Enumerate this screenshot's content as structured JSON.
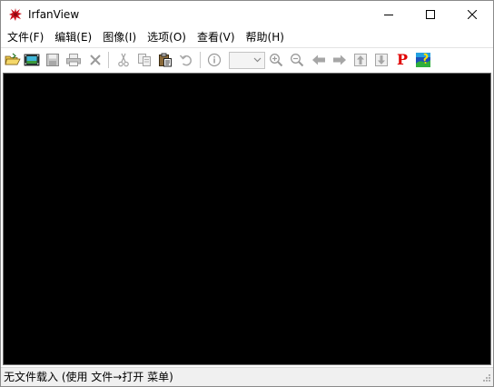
{
  "window": {
    "title": "IrfanView",
    "icon": "irfanview-logo-icon"
  },
  "caption_buttons": [
    {
      "name": "minimize",
      "icon": "minimize-icon"
    },
    {
      "name": "maximize",
      "icon": "maximize-icon"
    },
    {
      "name": "close",
      "icon": "close-icon"
    }
  ],
  "menu": [
    {
      "label": "文件(F)"
    },
    {
      "label": "编辑(E)"
    },
    {
      "label": "图像(I)"
    },
    {
      "label": "选项(O)"
    },
    {
      "label": "查看(V)"
    },
    {
      "label": "帮助(H)"
    }
  ],
  "toolbar": {
    "buttons": [
      {
        "icon": "open-folder-icon",
        "enabled": true
      },
      {
        "icon": "slideshow-icon",
        "enabled": true
      },
      {
        "icon": "save-icon",
        "enabled": false
      },
      {
        "icon": "print-icon",
        "enabled": false
      },
      {
        "icon": "delete-icon",
        "enabled": false
      },
      {
        "icon": "cut-icon",
        "enabled": false
      },
      {
        "icon": "copy-icon",
        "enabled": false
      },
      {
        "icon": "paste-icon",
        "enabled": true
      },
      {
        "icon": "undo-icon",
        "enabled": false
      },
      {
        "icon": "info-icon",
        "enabled": false
      },
      {
        "icon": "zoom-in-icon",
        "enabled": false
      },
      {
        "icon": "zoom-out-icon",
        "enabled": false
      },
      {
        "icon": "previous-icon",
        "enabled": false
      },
      {
        "icon": "next-icon",
        "enabled": false
      },
      {
        "icon": "first-icon",
        "enabled": false
      },
      {
        "icon": "last-icon",
        "enabled": false
      },
      {
        "icon": "paint-icon",
        "enabled": true
      },
      {
        "icon": "skin-icon",
        "enabled": true
      }
    ],
    "zoom_combo": {
      "value": ""
    },
    "paint_label": "P"
  },
  "status": {
    "text": "无文件载入 (使用 文件→打开 菜单)"
  },
  "colors": {
    "viewport_bg": "#000000",
    "paint_red": "#e00000"
  }
}
